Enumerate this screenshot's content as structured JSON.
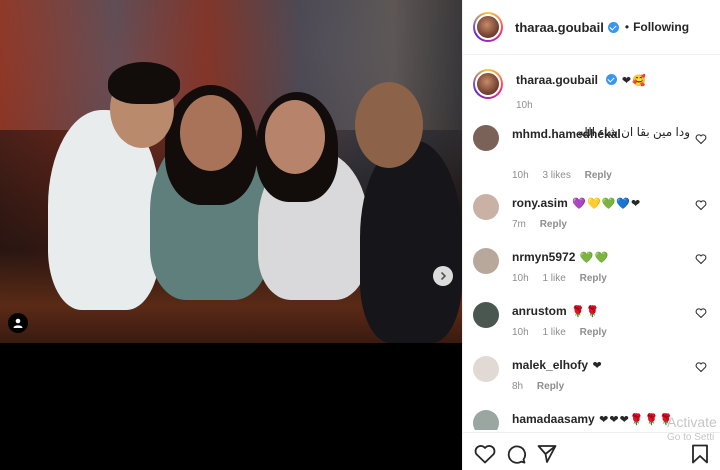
{
  "header": {
    "username": "tharaa.goubail",
    "separator": "•",
    "follow_status": "Following"
  },
  "caption": {
    "username": "tharaa.goubail",
    "emojis": "❤🥰",
    "time": "10h"
  },
  "comments": [
    {
      "username": "mhmd.hamedhekal",
      "text": "ودا مين بقا ان شاء الله",
      "time": "10h",
      "likes": "3 likes",
      "reply": "Reply",
      "avatar_color": "#7a6258"
    },
    {
      "username": "rony.asim",
      "text": "💜💛💚💙❤",
      "time": "7m",
      "likes": "",
      "reply": "Reply",
      "avatar_color": "#c9b2a5"
    },
    {
      "username": "nrmyn5972",
      "text": "💚💚",
      "time": "10h",
      "likes": "1 like",
      "reply": "Reply",
      "avatar_color": "#b8a89c"
    },
    {
      "username": "anrustom",
      "text": "🌹🌹",
      "time": "10h",
      "likes": "1 like",
      "reply": "Reply",
      "avatar_color": "#4a5650"
    },
    {
      "username": "malek_elhofy",
      "text": "❤",
      "time": "8h",
      "likes": "",
      "reply": "Reply",
      "avatar_color": "#e0d9d4"
    },
    {
      "username": "hamadaasamy",
      "text": "❤❤❤🌹🌹🌹",
      "time": "",
      "likes": "",
      "reply": "",
      "avatar_color": "#9aa6a0"
    }
  ],
  "actions": {
    "like": "heart-outline-icon",
    "comment": "comment-icon",
    "share": "paper-plane-icon",
    "save": "bookmark-icon"
  },
  "watermark": {
    "line1": "Activate",
    "line2": "Go to Setti"
  },
  "colors": {
    "verified": "#3897f0",
    "muted_text": "#8e8e8e",
    "border": "#efefef"
  }
}
